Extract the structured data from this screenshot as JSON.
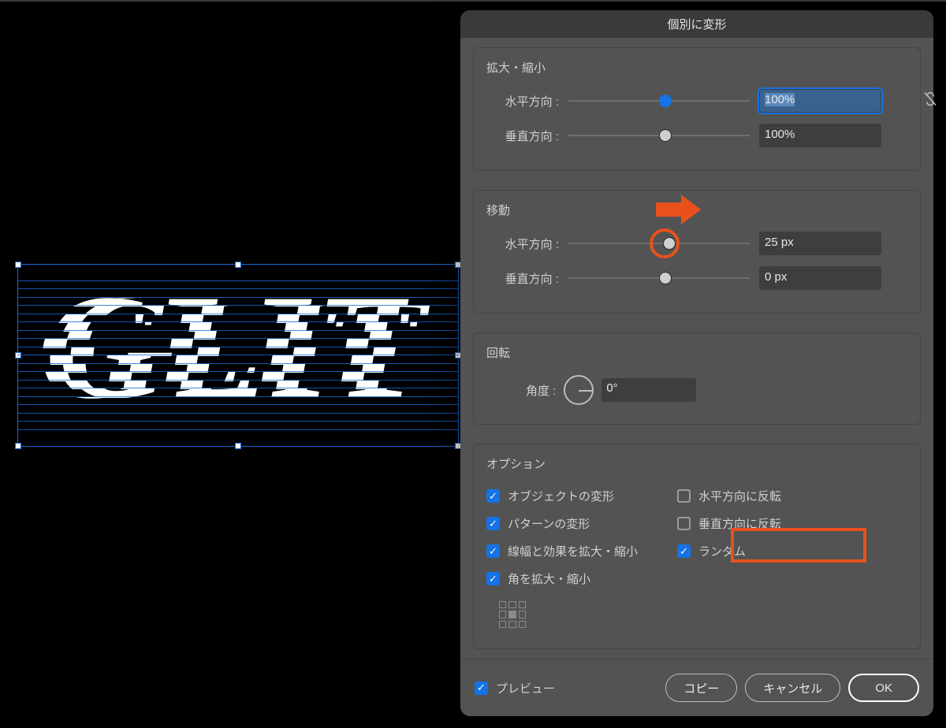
{
  "dialog": {
    "title": "個別に変形",
    "scale": {
      "title": "拡大・縮小",
      "h_label": "水平方向 :",
      "v_label": "垂直方向 :",
      "h_value": "100%",
      "v_value": "100%"
    },
    "move": {
      "title": "移動",
      "h_label": "水平方向 :",
      "v_label": "垂直方向 :",
      "h_value": "25 px",
      "v_value": "0 px"
    },
    "rotate": {
      "title": "回転",
      "label": "角度 :",
      "value": "0°"
    },
    "options": {
      "title": "オプション",
      "left": [
        {
          "label": "オブジェクトの変形",
          "checked": true
        },
        {
          "label": "パターンの変形",
          "checked": true
        },
        {
          "label": "線幅と効果を拡大・縮小",
          "checked": true
        },
        {
          "label": "角を拡大・縮小",
          "checked": true
        }
      ],
      "right": [
        {
          "label": "水平方向に反転",
          "checked": false
        },
        {
          "label": "垂直方向に反転",
          "checked": false
        },
        {
          "label": "ランダム",
          "checked": true
        }
      ]
    },
    "footer": {
      "preview": "プレビュー",
      "copy": "コピー",
      "cancel": "キャンセル",
      "ok": "OK"
    }
  },
  "artwork": {
    "text": "GLIT"
  },
  "annotations": {
    "arrow_color": "#e8511b",
    "highlight_color": "#e8511b"
  }
}
